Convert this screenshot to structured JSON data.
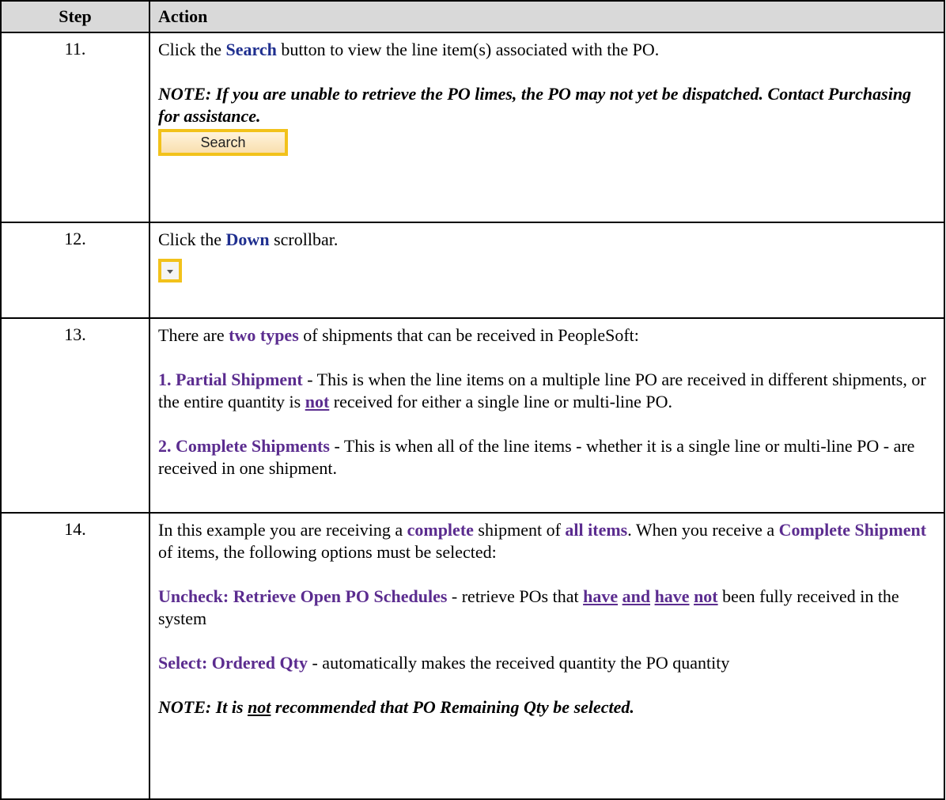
{
  "header": {
    "step": "Step",
    "action": "Action"
  },
  "rows": [
    {
      "step": "11.",
      "p1_a": "Click the ",
      "p1_b": "Search",
      "p1_c": " button to view the line item(s) associated with the PO.",
      "note": "NOTE: If you are unable to retrieve the PO limes, the PO may not yet be dispatched. Contact Purchasing for assistance.",
      "button_label": "Search"
    },
    {
      "step": "12.",
      "p1_a": "Click the ",
      "p1_b": "Down",
      "p1_c": " scrollbar.",
      "icon": "chevron-down-icon"
    },
    {
      "step": "13.",
      "p1_a": "There are ",
      "p1_b": "two types",
      "p1_c": " of shipments that can be received in PeopleSoft:",
      "p2_a": "1. Partial Shipment",
      "p2_b": " - This is when the line items on a multiple line PO are received in different shipments, or the entire quantity is ",
      "p2_c": "not",
      "p2_d": " received for either a single line or multi-line PO.",
      "p3_a": "2. Complete Shipments",
      "p3_b": " - This is when all of the line items - whether it is a single line or multi-line PO - are received in one shipment."
    },
    {
      "step": "14.",
      "p1_a": "In this example you are receiving a ",
      "p1_b": "complete",
      "p1_c": " shipment of ",
      "p1_d": "all items",
      "p1_e": ". When you receive a ",
      "p1_f": "Complete Shipment",
      "p1_g": " of items, the following options must be selected:",
      "p2_a": "Uncheck: Retrieve Open PO Schedules",
      "p2_b": " - retrieve POs that ",
      "p2_c": "have",
      "p2_d": "and",
      "p2_e": "have",
      "p2_f": "not",
      "p2_g": " been fully received in the system",
      "p3_a": "Select: Ordered Qty",
      "p3_b": " - automatically makes the received quantity the PO quantity",
      "note_a": "NOTE: It is ",
      "note_b": "not",
      "note_c": " recommended that PO Remaining Qty be selected."
    }
  ],
  "colors": {
    "highlight": "#5b2c8f",
    "link_blue": "#1f2f8f",
    "button_border": "#f2c21b",
    "header_bg": "#d9d9d9"
  }
}
